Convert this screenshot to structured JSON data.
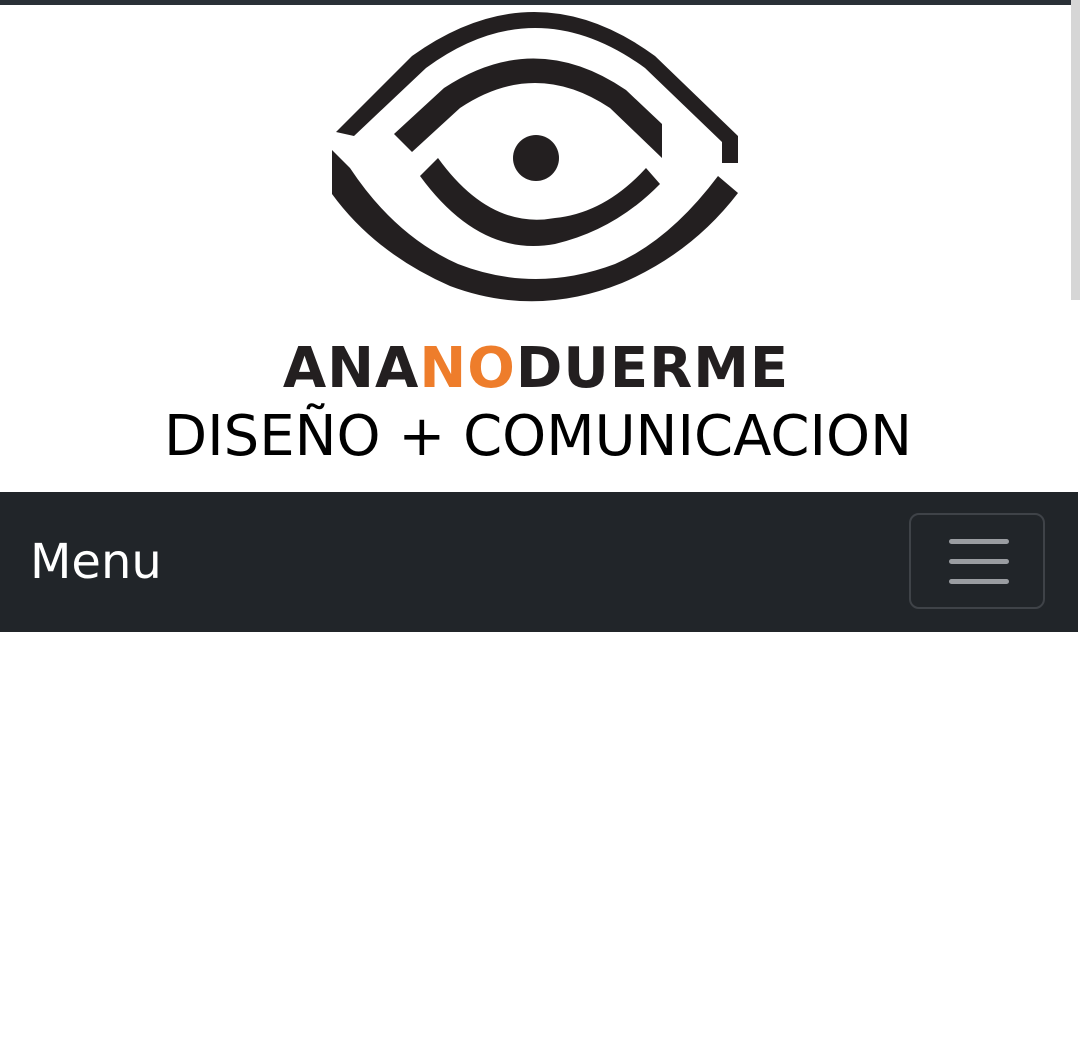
{
  "brand": {
    "name_prefix": "ANA",
    "name_accent": "NO",
    "name_suffix": "DUERME",
    "tagline": "DISEÑO + COMUNICACION",
    "logo_icon": "eye-logo-icon",
    "accent_color": "#ee7d2b",
    "text_color": "#231f20"
  },
  "navbar": {
    "menu_label": "Menu",
    "toggle_icon": "hamburger-menu-icon",
    "background_color": "#212529"
  }
}
